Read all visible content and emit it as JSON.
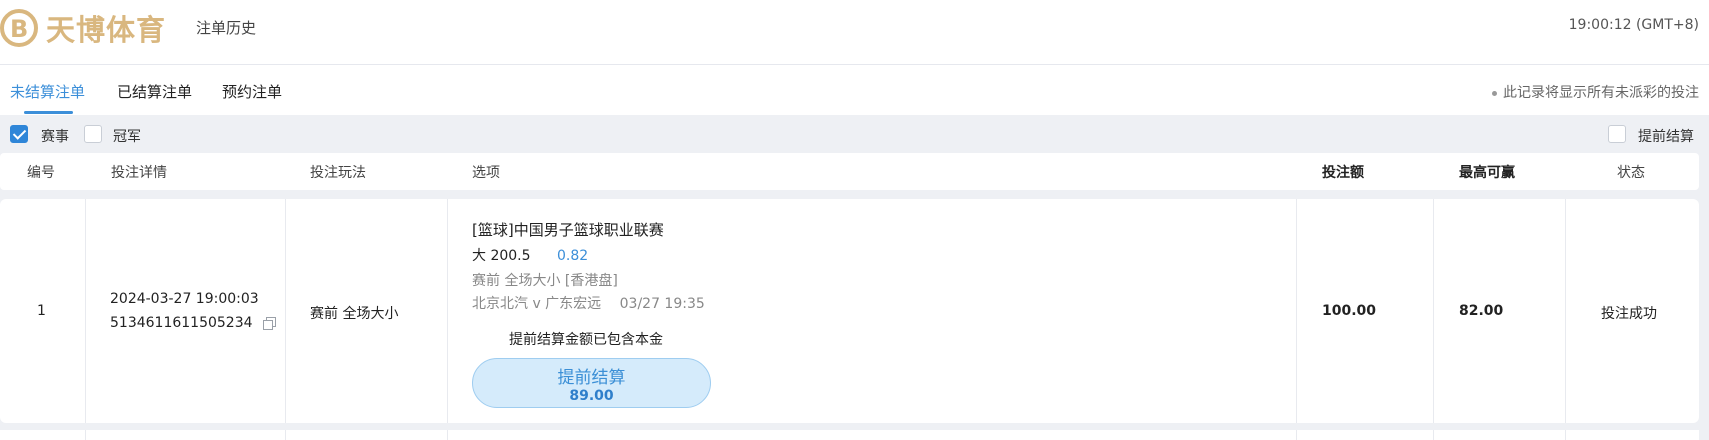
{
  "header": {
    "logo_text": "天博体育",
    "history_link": "注单历史",
    "clock": "19:00:12 (GMT+8)"
  },
  "tabs": [
    {
      "label": "未结算注单",
      "active": true
    },
    {
      "label": "已结算注单",
      "active": false
    },
    {
      "label": "预约注单",
      "active": false
    }
  ],
  "notice": "此记录将显示所有未派彩的投注",
  "filters": {
    "event": {
      "label": "赛事",
      "checked": true
    },
    "champion": {
      "label": "冠军",
      "checked": false
    },
    "cashout": {
      "label": "提前结算",
      "checked": false
    }
  },
  "columns": {
    "no": "编号",
    "detail": "投注详情",
    "play": "投注玩法",
    "option": "选项",
    "stake": "投注额",
    "max_win": "最高可赢",
    "status": "状态"
  },
  "bets": [
    {
      "no": "1",
      "datetime": "2024-03-27 19:00:03",
      "bet_id": "5134611611505234",
      "play": "赛前 全场大小",
      "league": "[篮球]中国男子篮球职业联赛",
      "selection": "大 200.5",
      "odds": "0.82",
      "market_info": "赛前   全场大小   [香港盘]",
      "match": "北京北汽 v 广东宏远",
      "match_time": "03/27 19:35",
      "cashout_note": "提前结算金额已包含本金",
      "cashout_label": "提前结算",
      "cashout_amount": "89.00",
      "stake": "100.00",
      "max_win": "82.00",
      "status": "投注成功"
    }
  ],
  "colors": {
    "accent": "#3c8fd9",
    "logo_gold": "#d9b77f",
    "background": "#eef0f4"
  }
}
